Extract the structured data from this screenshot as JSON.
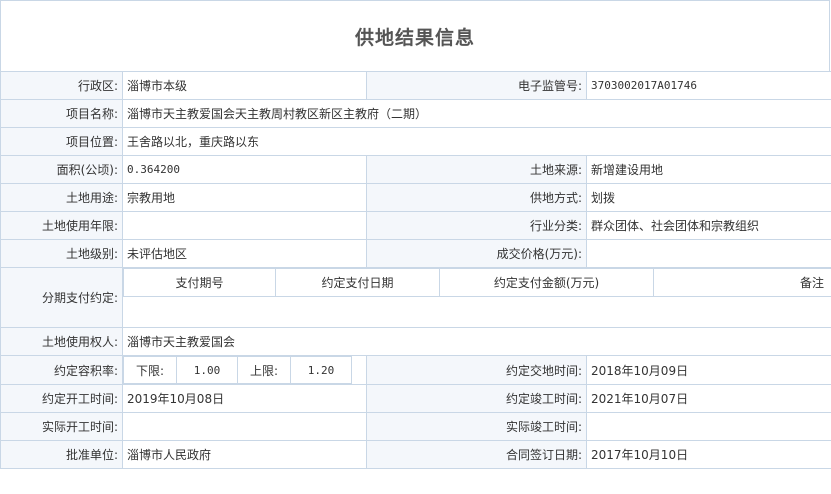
{
  "title": "供地结果信息",
  "fields": {
    "district_label": "行政区:",
    "district_value": "淄博市本级",
    "supervision_no_label": "电子监管号:",
    "supervision_no_value": "3703002017A01746",
    "project_name_label": "项目名称:",
    "project_name_value": "淄博市天主教爱国会天主教周村教区新区主教府（二期）",
    "project_location_label": "项目位置:",
    "project_location_value": "王舍路以北，重庆路以东",
    "area_label": "面积(公顷):",
    "area_value": "0.364200",
    "land_source_label": "土地来源:",
    "land_source_value": "新增建设用地",
    "land_use_label": "土地用途:",
    "land_use_value": "宗教用地",
    "supply_method_label": "供地方式:",
    "supply_method_value": "划拨",
    "use_years_label": "土地使用年限:",
    "use_years_value": "",
    "industry_label": "行业分类:",
    "industry_value": "群众团体、社会团体和宗教组织",
    "land_grade_label": "土地级别:",
    "land_grade_value": "未评估地区",
    "deal_price_label": "成交价格(万元):",
    "deal_price_value": "",
    "installment_label": "分期支付约定:",
    "land_user_label": "土地使用权人:",
    "land_user_value": "淄博市天主教爱国会",
    "far_label": "约定容积率:",
    "far_lower_label": "下限:",
    "far_lower_value": "1.00",
    "far_upper_label": "上限:",
    "far_upper_value": "1.20",
    "delivery_time_label": "约定交地时间:",
    "delivery_time_value": "2018年10月09日",
    "start_time_label": "约定开工时间:",
    "start_time_value": "2019年10月08日",
    "completion_time_label": "约定竣工时间:",
    "completion_time_value": "2021年10月07日",
    "actual_start_label": "实际开工时间:",
    "actual_start_value": "",
    "actual_completion_label": "实际竣工时间:",
    "actual_completion_value": "",
    "approver_label": "批准单位:",
    "approver_value": "淄博市人民政府",
    "contract_date_label": "合同签订日期:",
    "contract_date_value": "2017年10月10日"
  },
  "installment_table": {
    "headers": [
      "支付期号",
      "约定支付日期",
      "约定支付金额(万元)",
      "备注"
    ]
  }
}
